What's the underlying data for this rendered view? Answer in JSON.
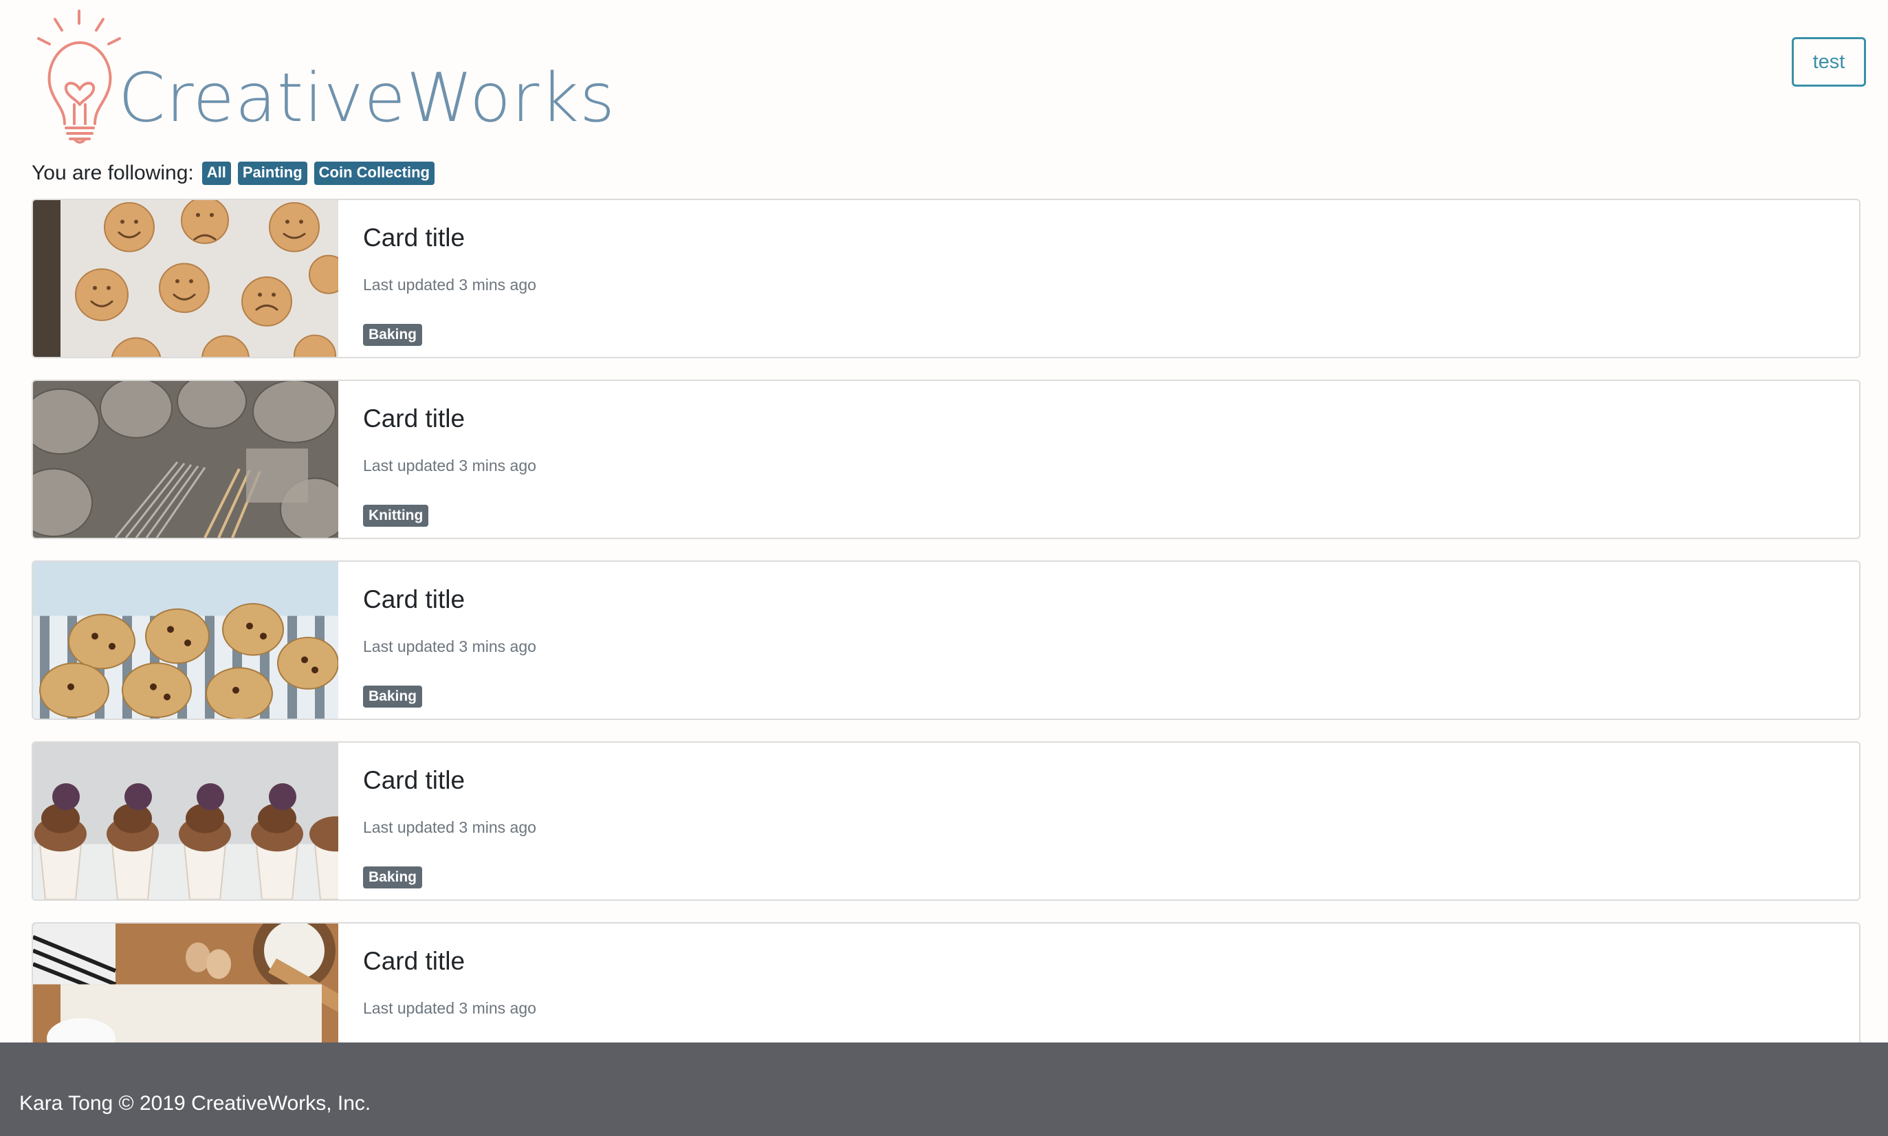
{
  "header": {
    "brand": "CreativeWorks",
    "user_button": "test"
  },
  "following": {
    "label": "You are following:",
    "topics": [
      "All",
      "Painting",
      "Coin Collecting"
    ]
  },
  "cards": [
    {
      "title": "Card title",
      "meta": "Last updated 3 mins ago",
      "tag": "Baking",
      "image": "smiley-cookies"
    },
    {
      "title": "Card title",
      "meta": "Last updated 3 mins ago",
      "tag": "Knitting",
      "image": "yarn-needles"
    },
    {
      "title": "Card title",
      "meta": "Last updated 3 mins ago",
      "tag": "Baking",
      "image": "chocolate-chip-cookies"
    },
    {
      "title": "Card title",
      "meta": "Last updated 3 mins ago",
      "tag": "Baking",
      "image": "chocolate-cupcakes"
    },
    {
      "title": "Card title",
      "meta": "Last updated 3 mins ago",
      "tag": "",
      "image": "baking-flour"
    }
  ],
  "footer": {
    "text": "Kara Tong © 2019 CreativeWorks, Inc."
  },
  "colors": {
    "brand_text": "#6f92ad",
    "bulb": "#e98b80",
    "topic_badge": "#2e6a8a",
    "card_badge": "#5f6a73",
    "footer_bg": "#5c5e63",
    "button_border": "#3a90a8"
  }
}
